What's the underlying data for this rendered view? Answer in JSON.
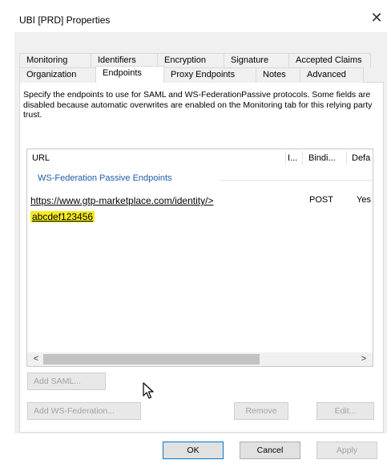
{
  "window": {
    "title": "UBI [PRD] Properties",
    "close_symbol": "✕"
  },
  "tabs_row1": [
    "Monitoring",
    "Identifiers",
    "Encryption",
    "Signature",
    "Accepted Claims"
  ],
  "tabs_row2": [
    "Organization",
    "Endpoints",
    "Proxy Endpoints",
    "Notes",
    "Advanced"
  ],
  "active_tab": "Endpoints",
  "description": "Specify the endpoints to use for SAML and WS-FederationPassive protocols. Some fields are disabled because automatic overwrites are enabled on the Monitoring tab for this relying party trust.",
  "endpoints_list": {
    "columns": [
      "URL",
      "I...",
      "Bindi...",
      "Defa"
    ],
    "group_label": "WS-Federation Passive Endpoints",
    "row": {
      "url_line1": "https://www.gtp-marketplace.com/identity/>",
      "url_line2": "abcdef123456",
      "binding": "POST",
      "default": "Yes"
    },
    "scroll_left": "<",
    "scroll_right": ">"
  },
  "buttons": {
    "add_saml": "Add SAML...",
    "add_ws_federation": "Add WS-Federation...",
    "remove": "Remove",
    "edit": "Edit...",
    "ok": "OK",
    "cancel": "Cancel",
    "apply": "Apply"
  },
  "colors": {
    "highlight": "#f5ea1f",
    "group_label": "#1e5da8",
    "panel_bg": "#f0f0f0"
  }
}
